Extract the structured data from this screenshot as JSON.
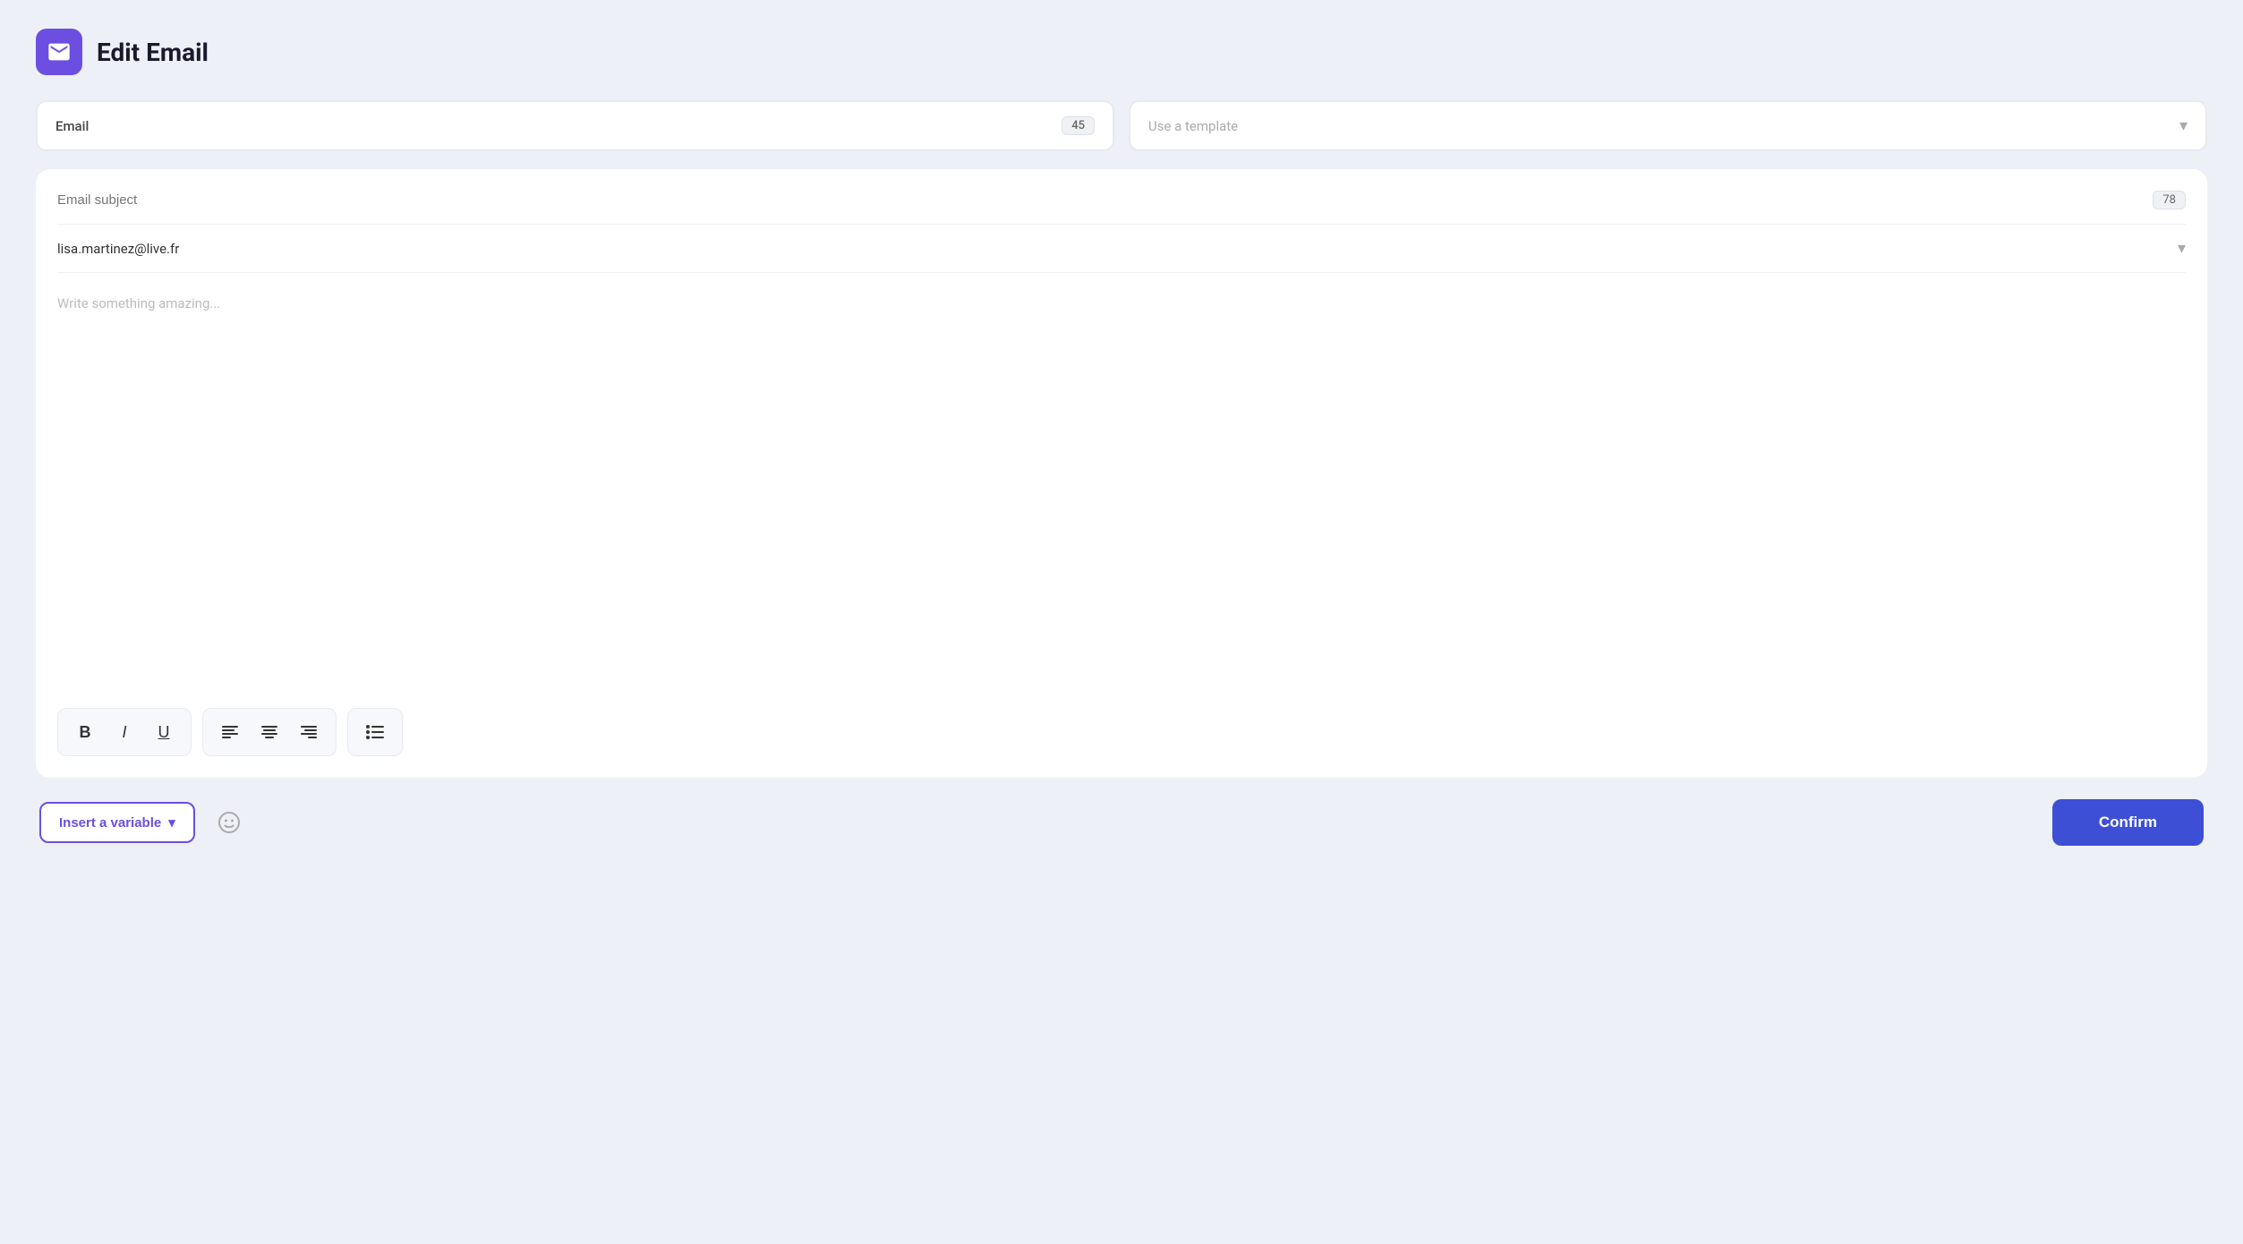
{
  "header": {
    "icon_label": "email-icon",
    "title": "Edit Email"
  },
  "top_controls": {
    "email_tab": {
      "label": "Email",
      "count": "45"
    },
    "template_select": {
      "placeholder": "Use a template",
      "chevron": "▾"
    }
  },
  "editor": {
    "subject": {
      "placeholder": "Email subject",
      "count": "78"
    },
    "recipient": {
      "email": "lisa.martinez@live.fr",
      "chevron": "▾"
    },
    "body": {
      "placeholder": "Write something amazing..."
    },
    "toolbar": {
      "group1": {
        "bold_label": "B",
        "italic_label": "I",
        "underline_label": "U"
      },
      "group2": {
        "align_left": "≡",
        "align_center": "≡",
        "align_right": "≡"
      },
      "group3": {
        "list_label": "☰"
      }
    }
  },
  "bottom_bar": {
    "insert_variable_label": "Insert a variable",
    "insert_chevron": "▾",
    "confirm_label": "Confirm"
  }
}
